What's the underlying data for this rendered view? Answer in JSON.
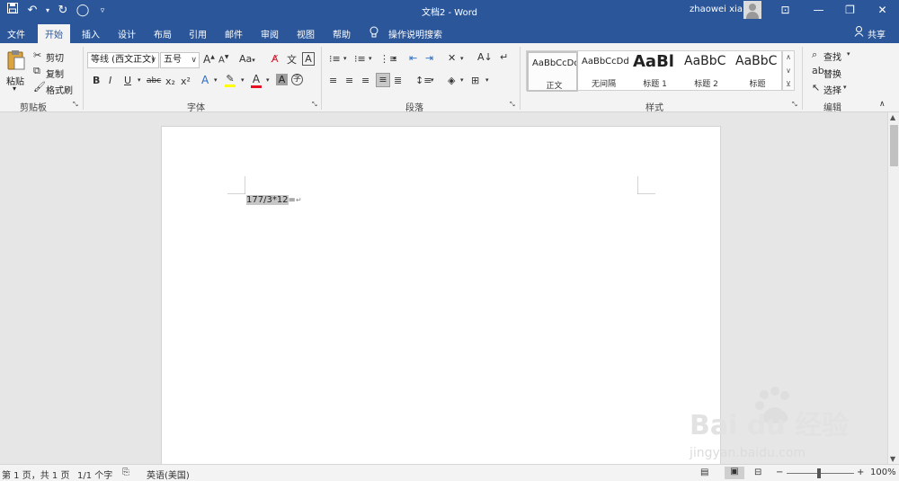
{
  "window": {
    "title": "文档2 - Word",
    "user": "zhaowei xia"
  },
  "qat": {
    "save_icon": "save-icon",
    "undo_icon": "undo-icon",
    "redo_icon": "redo-icon",
    "touch_icon": "touch-mode-icon",
    "customize_icon": "customize-qat-icon"
  },
  "tabs": [
    "文件",
    "开始",
    "插入",
    "设计",
    "布局",
    "引用",
    "邮件",
    "审阅",
    "视图",
    "帮助"
  ],
  "active_tab": "开始",
  "tell_me": "操作说明搜索",
  "share": "共享",
  "clipboard": {
    "paste": "粘贴",
    "cut": "剪切",
    "copy": "复制",
    "format_painter": "格式刷",
    "group": "剪贴板"
  },
  "font": {
    "name": "等线 (西文正文)",
    "size": "五号",
    "group": "字体",
    "case_label": "Aa",
    "bold": "B",
    "italic": "I",
    "underline": "U",
    "strike": "abc",
    "sub": "x₂",
    "sup": "x²",
    "grow": "A",
    "shrink": "A"
  },
  "paragraph": {
    "group": "段落"
  },
  "styles": {
    "group": "样式",
    "items": [
      {
        "preview": "AaBbCcDd",
        "label": "正文"
      },
      {
        "preview": "AaBbCcDd",
        "label": "无间隔"
      },
      {
        "preview": "AaBl",
        "label": "标题 1"
      },
      {
        "preview": "AaBbC",
        "label": "标题 2"
      },
      {
        "preview": "AaBbC",
        "label": "标题"
      }
    ]
  },
  "editing": {
    "find": "查找",
    "replace": "替换",
    "select": "选择",
    "group": "编辑"
  },
  "document": {
    "selected_text": "177/3*12",
    "rest_text": "="
  },
  "status": {
    "page": "第 1 页，共 1 页",
    "words": "1/1 个字",
    "language": "英语(美国)",
    "zoom": "100%"
  },
  "watermark": {
    "logo_text": "Bai du 经验",
    "url": "jingyan.baidu.com"
  },
  "colors": {
    "accent": "#2b579a",
    "ribbon_bg": "#f3f3f3",
    "canvas": "#e6e6e6",
    "highlight": "#c6c6c6",
    "font_color_bar": "#e81123",
    "highlight_bar": "#ffff00"
  }
}
